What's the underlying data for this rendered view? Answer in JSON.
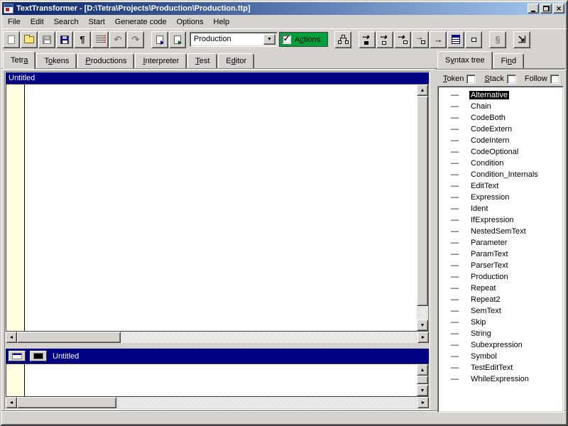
{
  "window": {
    "title": "TextTransformer - [D:\\Tetra\\Projects\\Production\\Production.ttp]"
  },
  "titlebar": {
    "buttons": [
      "minimize",
      "restore",
      "close"
    ]
  },
  "menu": {
    "items": [
      "File",
      "Edit",
      "Search",
      "Start",
      "Generate code",
      "Options",
      "Help"
    ]
  },
  "toolbar": {
    "buttons": [
      {
        "name": "new",
        "icon": "doc",
        "disabled": true
      },
      {
        "name": "open",
        "icon": "folder"
      },
      {
        "name": "save",
        "icon": "floppy",
        "disabled": true
      },
      {
        "name": "save-all",
        "icon": "floppy-blue"
      },
      {
        "name": "show-paragraphs",
        "icon": "pilcrow"
      },
      {
        "name": "format",
        "icon": "format"
      },
      {
        "name": "undo",
        "icon": "undo",
        "disabled": true
      },
      {
        "name": "redo",
        "icon": "redo",
        "disabled": true
      },
      {
        "type": "gap"
      },
      {
        "name": "parse-document",
        "icon": "doc-play"
      },
      {
        "name": "parse-all-documents",
        "icon": "doc-play2"
      },
      {
        "type": "combo"
      },
      {
        "type": "actions"
      },
      {
        "type": "gap"
      },
      {
        "name": "syntax-tree",
        "icon": "tree"
      },
      {
        "type": "gap"
      },
      {
        "name": "step-into-token",
        "icon": "step-filled"
      },
      {
        "name": "step-into",
        "icon": "step-hollow"
      },
      {
        "name": "step-to-new",
        "icon": "step-plus"
      },
      {
        "name": "step-over",
        "icon": "step-over"
      },
      {
        "name": "run",
        "icon": "arrow"
      },
      {
        "name": "show-log",
        "icon": "list"
      },
      {
        "name": "breakpoint",
        "icon": "small-square"
      },
      {
        "type": "gap"
      },
      {
        "name": "stop",
        "icon": "section",
        "disabled": true
      },
      {
        "type": "gap"
      },
      {
        "name": "goto-node",
        "icon": "godown"
      }
    ],
    "production_combo": {
      "value": "Production"
    },
    "actions": {
      "pre": "A",
      "accel": "c",
      "post": "tions",
      "checked": true,
      "check_glyph": "✓"
    }
  },
  "tabs": {
    "main": [
      {
        "pre": "Tetr",
        "accel": "a",
        "post": "",
        "active": true
      },
      {
        "pre": "T",
        "accel": "o",
        "post": "kens",
        "active": false
      },
      {
        "pre": "",
        "accel": "P",
        "post": "roductions",
        "active": false
      },
      {
        "pre": "",
        "accel": "I",
        "post": "nterpreter",
        "active": false
      },
      {
        "pre": "",
        "accel": "T",
        "post": "est",
        "active": false
      },
      {
        "pre": "E",
        "accel": "d",
        "post": "itor",
        "active": false
      }
    ],
    "right": [
      {
        "pre": "S",
        "accel": "y",
        "post": "ntax tree",
        "active": true
      },
      {
        "pre": "Fi",
        "accel": "n",
        "post": "d",
        "active": false
      }
    ]
  },
  "editors": {
    "top": {
      "caption": "Untitled"
    },
    "bottom": {
      "caption": "Untitled"
    }
  },
  "right_panel": {
    "checkboxes": [
      {
        "pre": "",
        "accel": "T",
        "post": "oken",
        "checked": false
      },
      {
        "pre": "",
        "accel": "S",
        "post": "tack",
        "checked": false
      },
      {
        "pre": "Follow",
        "accel": "",
        "post": "",
        "checked": false
      }
    ],
    "tree": {
      "connector": "—",
      "selected_index": 0,
      "items": [
        "Alternative",
        "Chain",
        "CodeBoth",
        "CodeExtern",
        "CodeIntern",
        "CodeOptional",
        "Condition",
        "Condition_Internals",
        "EditText",
        "Expression",
        "Ident",
        "IfExpression",
        "NestedSemText",
        "Parameter",
        "ParamText",
        "ParserText",
        "Production",
        "Repeat",
        "Repeat2",
        "SemText",
        "Skip",
        "String",
        "Subexpression",
        "Symbol",
        "TestEditText",
        "WhileExpression"
      ]
    }
  },
  "colors": {
    "actions_green": "#00a13c",
    "caption_blue": "#000084",
    "titlebar_gradient_start": "#0a246a",
    "titlebar_gradient_end": "#a6caf0",
    "gutter_yellow": "#ffffe1",
    "selection_bg": "#000000"
  },
  "scroll_glyphs": {
    "up": "▲",
    "down": "▼",
    "left": "◄",
    "right": "►"
  }
}
